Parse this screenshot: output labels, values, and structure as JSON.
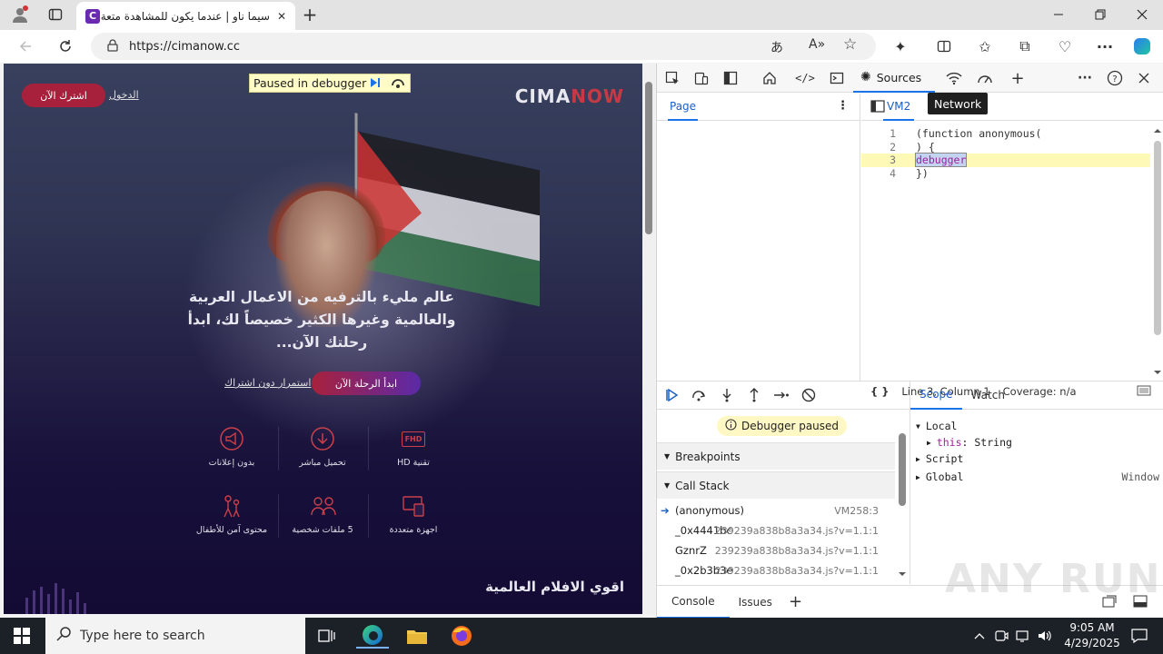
{
  "browser": {
    "tab_title": "سيما ناو | عندما يكون للمشاهدة متعة",
    "tab_favicon": "C",
    "url": "https://cimanow.cc",
    "new_tab": "+",
    "close_tab": "✕"
  },
  "page": {
    "logo_a": "CIMA",
    "logo_b": "NOW",
    "signup_label": "اشترك الآن",
    "login_label": "الدخول",
    "hero_text": "عالم مليء بالترفيه من الاعمال العربية والعالمية وغيرها الكثير خصيصاً لك، ابدأ رحلتك الآن...",
    "start_label": "ابدأ الرحلة الآن",
    "continue_label": "استمرار دون اشتراك",
    "features": [
      {
        "label": "بدون إعلانات",
        "icon": "megaphone-icon"
      },
      {
        "label": "تحميل مباشر",
        "icon": "download-icon"
      },
      {
        "label": "تقنية HD",
        "icon": "fhd-icon",
        "badge": "FHD"
      },
      {
        "label": "محتوى آمن للأطفال",
        "icon": "kids-icon"
      },
      {
        "label": "5 ملفات شخصية",
        "icon": "profiles-icon"
      },
      {
        "label": "اجهزة متعددة",
        "icon": "devices-icon"
      }
    ],
    "section_title": "اقوي الافلام العالمية",
    "paused_banner": "Paused in debugger"
  },
  "devtools": {
    "sources_tab": "Sources",
    "network_tooltip": "Network",
    "nav_tab": "Page",
    "file_tab": "VM2",
    "code_lines": [
      {
        "n": "1",
        "text": "(function anonymous("
      },
      {
        "n": "2",
        "text": ") {"
      },
      {
        "n": "3",
        "text": "debugger"
      },
      {
        "n": "4",
        "text": "})"
      }
    ],
    "status_braces": "{ }",
    "status_position": "Line 3, Column 1",
    "status_coverage": "Coverage: n/a",
    "debugger_paused": "Debugger paused",
    "breakpoints_label": "Breakpoints",
    "call_stack_label": "Call Stack",
    "call_stack": [
      {
        "fn": "(anonymous)",
        "loc": "VM258:3"
      },
      {
        "fn": "_0x4441bc",
        "loc": "239239a838b8a3a34.js?v=1.1:1"
      },
      {
        "fn": "GznrZ",
        "loc": "239239a838b8a3a34.js?v=1.1:1"
      },
      {
        "fn": "_0x2b3b3e",
        "loc": "239239a838b8a3a34.js?v=1.1:1"
      }
    ],
    "scope_tab": "Scope",
    "watch_tab": "Watch",
    "scope": {
      "local": "Local",
      "this_key": "this",
      "this_val": ": String",
      "script": "Script",
      "global": "Global",
      "global_val": "Window"
    },
    "drawer_console": "Console",
    "drawer_issues": "Issues",
    "drawer_add": "+"
  },
  "taskbar": {
    "search_placeholder": "Type here to search",
    "time": "9:05 AM",
    "date": "4/29/2025"
  },
  "watermark": "ANY RUN"
}
